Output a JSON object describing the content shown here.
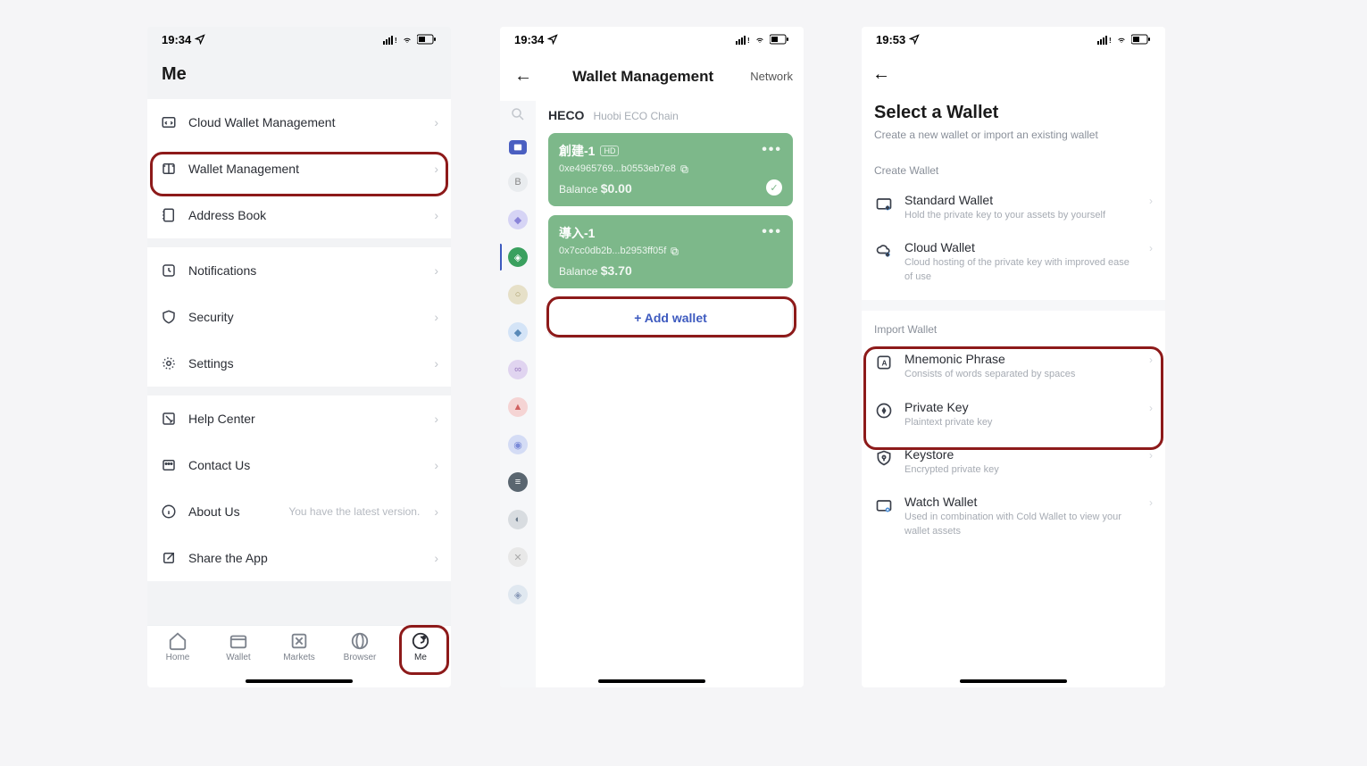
{
  "screen1": {
    "time": "19:34",
    "header": "Me",
    "rows": {
      "cloud_wallet": "Cloud Wallet Management",
      "wallet_mgmt": "Wallet Management",
      "address_book": "Address Book",
      "notifications": "Notifications",
      "security": "Security",
      "settings": "Settings",
      "help_center": "Help Center",
      "contact_us": "Contact Us",
      "about_us": "About Us",
      "about_us_sub": "You have the latest version.",
      "share": "Share the App"
    },
    "tabs": {
      "home": "Home",
      "wallet": "Wallet",
      "markets": "Markets",
      "browser": "Browser",
      "me": "Me"
    }
  },
  "screen2": {
    "time": "19:34",
    "title": "Wallet Management",
    "network": "Network",
    "chain_name": "HECO",
    "chain_sub": "Huobi ECO Chain",
    "wallet1": {
      "name": "創建-1",
      "badge": "HD",
      "addr": "0xe4965769...b0553eb7e8",
      "bal_label": "Balance",
      "bal": "$0.00"
    },
    "wallet2": {
      "name": "導入-1",
      "addr": "0x7cc0db2b...b2953ff05f",
      "bal_label": "Balance",
      "bal": "$3.70"
    },
    "add_wallet": "Add wallet"
  },
  "screen3": {
    "time": "19:53",
    "title": "Select a Wallet",
    "subtitle": "Create a new wallet or import an existing wallet",
    "create_label": "Create Wallet",
    "import_label": "Import Wallet",
    "standard": {
      "t": "Standard Wallet",
      "d": "Hold the private key to your assets by yourself"
    },
    "cloud": {
      "t": "Cloud Wallet",
      "d": "Cloud hosting of the private key with improved ease of use"
    },
    "mnemonic": {
      "t": "Mnemonic Phrase",
      "d": "Consists of words separated by spaces"
    },
    "private_key": {
      "t": "Private Key",
      "d": "Plaintext private key"
    },
    "keystore": {
      "t": "Keystore",
      "d": "Encrypted private key"
    },
    "watch": {
      "t": "Watch Wallet",
      "d": "Used in combination with Cold Wallet to view your wallet assets"
    }
  }
}
